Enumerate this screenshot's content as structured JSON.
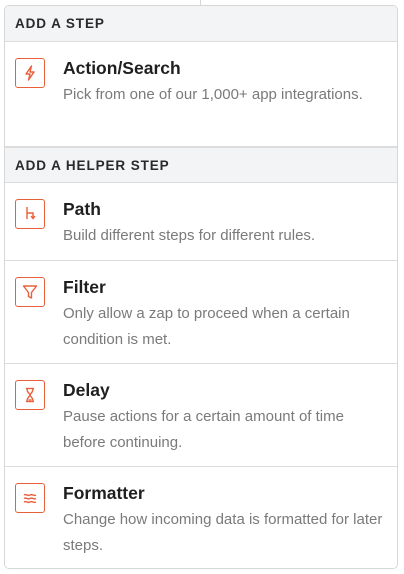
{
  "sections": [
    {
      "header": "ADD A STEP",
      "items": [
        {
          "title": "Action/Search",
          "description": "Pick from one of our 1,000+ app integrations.",
          "icon": "lightning-bolt-icon"
        }
      ]
    },
    {
      "header": "ADD A HELPER STEP",
      "items": [
        {
          "title": "Path",
          "description": "Build different steps for different rules.",
          "icon": "path-branch-icon"
        },
        {
          "title": "Filter",
          "description": "Only allow a zap to proceed when a certain condition is met.",
          "icon": "filter-funnel-icon"
        },
        {
          "title": "Delay",
          "description": "Pause actions for a certain amount of time before continuing.",
          "icon": "hourglass-icon"
        },
        {
          "title": "Formatter",
          "description": "Change how incoming data is formatted for later steps.",
          "icon": "formatter-waves-icon"
        }
      ]
    }
  ],
  "colors": {
    "accent": "#e8603a",
    "header_bg": "#f3f4f6",
    "title_text": "#1f1f1f",
    "desc_text": "#7a7a7a",
    "border": "#dcdcdc"
  }
}
